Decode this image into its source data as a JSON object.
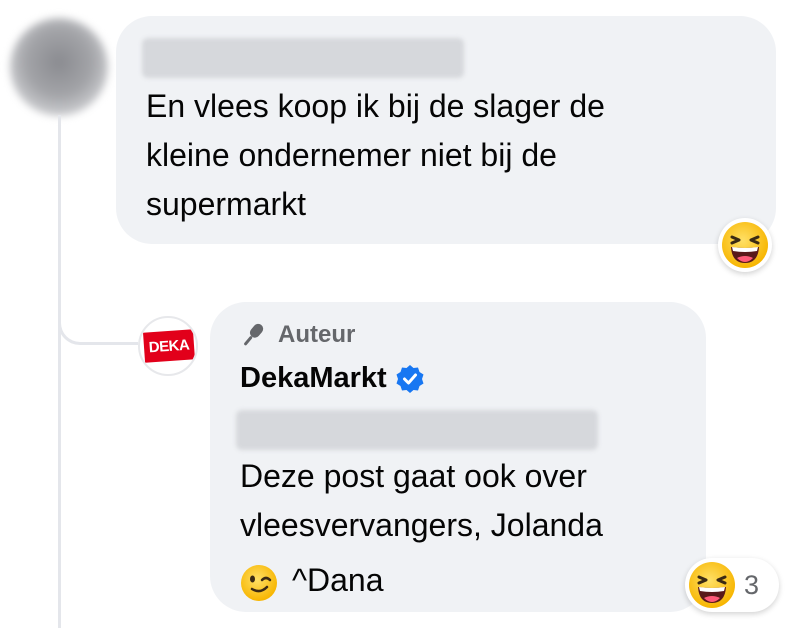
{
  "comment": {
    "author_name": "",
    "text": "En vlees koop ik bij de slager de\nkleine ondernemer niet bij de\nsupermarkt",
    "reaction": {
      "emoji": "grinning-squinting-face"
    }
  },
  "reply": {
    "badge": "Auteur",
    "page_name": "DekaMarkt",
    "verified": true,
    "avatar_logo_text": "DEKA",
    "avatar_color": "#e2001a",
    "tagged_name": "",
    "text": "Deze post gaat ook over\nvleesvervangers, Jolanda",
    "signature": "^Dana",
    "reaction": {
      "emoji": "grinning-squinting-face",
      "count": "3"
    }
  },
  "colors": {
    "bubble": "#f0f2f5",
    "verified_blue": "#1877f2",
    "secondary_text": "#65676b"
  }
}
